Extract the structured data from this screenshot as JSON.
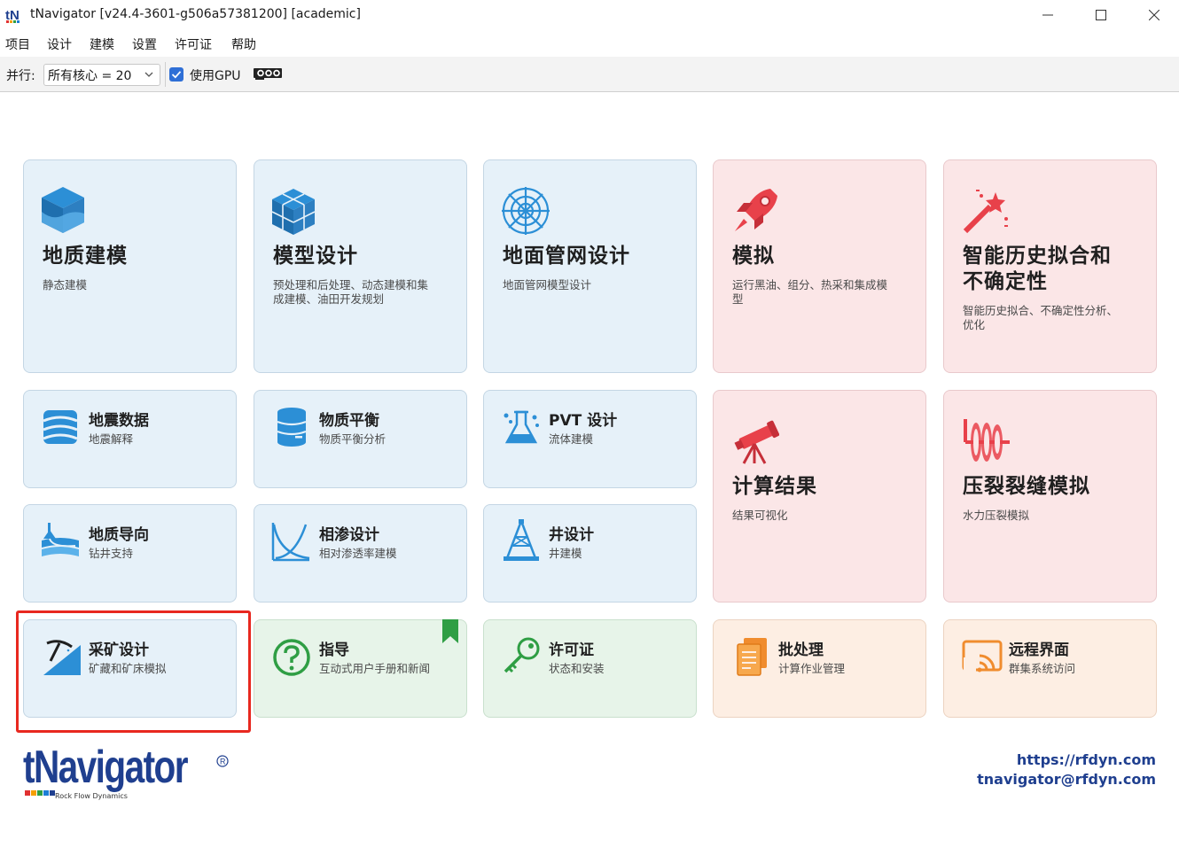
{
  "window": {
    "title": "tNavigator [v24.4-3601-g506a57381200] [academic]"
  },
  "menu": {
    "items": [
      "项目",
      "设计",
      "建模",
      "设置",
      "许可证",
      "帮助"
    ]
  },
  "toolbar": {
    "parallel_label": "并行:",
    "cores_value": "所有核心 = 20",
    "gpu_checked": true,
    "gpu_label": "使用GPU"
  },
  "tiles": {
    "geology": {
      "title": "地质建模",
      "subtitle": "静态建模",
      "color": "blue",
      "icon": "cube-icon"
    },
    "model_design": {
      "title": "模型设计",
      "subtitle_lines": [
        "预处理和后处理、动态建模和集",
        "成建模、油田开发规划"
      ],
      "color": "blue",
      "icon": "cubes-icon"
    },
    "network": {
      "title": "地面管网设计",
      "subtitle": "地面管网模型设计",
      "color": "blue",
      "icon": "web-icon"
    },
    "simulation": {
      "title": "模拟",
      "subtitle_lines": [
        "运行黑油、组分、热采和集成模",
        "型"
      ],
      "color": "red",
      "icon": "rocket-icon"
    },
    "history": {
      "title_lines": [
        "智能历史拟合和",
        "不确定性"
      ],
      "subtitle_lines": [
        "智能历史拟合、不确定性分析、",
        "优化"
      ],
      "color": "red",
      "icon": "magic-wand-icon"
    },
    "seismic": {
      "title": "地震数据",
      "subtitle": "地震解释",
      "color": "blue",
      "icon": "seismic-icon"
    },
    "material": {
      "title": "物质平衡",
      "subtitle": "物质平衡分析",
      "color": "blue",
      "icon": "database-icon"
    },
    "pvt": {
      "title": "PVT 设计",
      "subtitle": "流体建模",
      "color": "blue",
      "icon": "flask-icon"
    },
    "results": {
      "title": "计算结果",
      "subtitle": "结果可视化",
      "color": "red",
      "icon": "telescope-icon"
    },
    "fracture": {
      "title": "压裂裂缝模拟",
      "subtitle": "水力压裂模拟",
      "color": "red",
      "icon": "fracture-icon"
    },
    "geosteering": {
      "title": "地质导向",
      "subtitle": "钻井支持",
      "color": "blue",
      "icon": "geosteering-icon"
    },
    "relperm": {
      "title": "相渗设计",
      "subtitle": "相对渗透率建模",
      "color": "blue",
      "icon": "curve-icon"
    },
    "well": {
      "title": "井设计",
      "subtitle": "井建模",
      "color": "blue",
      "icon": "derrick-icon"
    },
    "mining": {
      "title": "采矿设计",
      "subtitle": "矿藏和矿床模拟",
      "color": "blue",
      "icon": "pickaxe-icon"
    },
    "guide": {
      "title": "指导",
      "subtitle": "互动式用户手册和新闻",
      "color": "green",
      "icon": "question-icon"
    },
    "license": {
      "title": "许可证",
      "subtitle": "状态和安装",
      "color": "green",
      "icon": "key-icon"
    },
    "batch": {
      "title": "批处理",
      "subtitle": "计算作业管理",
      "color": "orange",
      "icon": "documents-icon"
    },
    "remote": {
      "title": "远程界面",
      "subtitle": "群集系统访问",
      "color": "orange",
      "icon": "remote-icon"
    }
  },
  "footer": {
    "brand": "tNavigator",
    "brand_tag": "Rock Flow Dynamics",
    "website": "https://rfdyn.com",
    "email": "tnavigator@rfdyn.com"
  }
}
